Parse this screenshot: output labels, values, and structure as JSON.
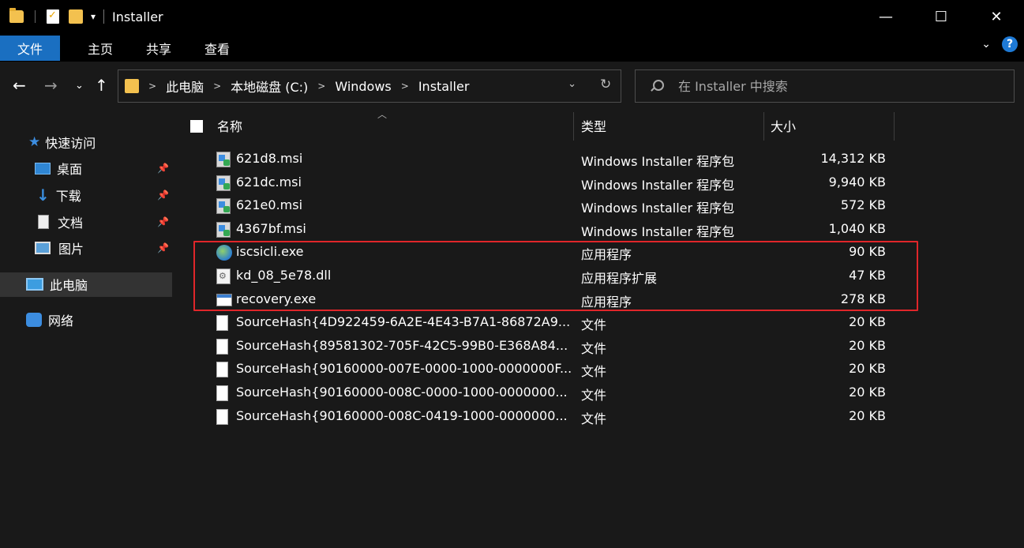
{
  "window": {
    "title": "Installer",
    "minimize": "—",
    "maximize": "☐",
    "close": "✕"
  },
  "ribbon": {
    "tabs": [
      "文件",
      "主页",
      "共享",
      "查看"
    ],
    "help": "?"
  },
  "address": {
    "crumbs": [
      "此电脑",
      "本地磁盘 (C:)",
      "Windows",
      "Installer"
    ],
    "search_placeholder": "在 Installer 中搜索"
  },
  "sidebar": {
    "quick_access": "快速访问",
    "items": [
      {
        "label": "桌面",
        "icon": "desktop-icon",
        "pinned": true
      },
      {
        "label": "下载",
        "icon": "download-icon",
        "pinned": true
      },
      {
        "label": "文档",
        "icon": "document-icon",
        "pinned": true
      },
      {
        "label": "图片",
        "icon": "picture-icon",
        "pinned": true
      }
    ],
    "this_pc": "此电脑",
    "network": "网络"
  },
  "columns": {
    "name": "名称",
    "type": "类型",
    "size": "大小"
  },
  "files": [
    {
      "name": "621d8.msi",
      "type": "Windows Installer 程序包",
      "size": "14,312 KB",
      "icon": "msi-icon"
    },
    {
      "name": "621dc.msi",
      "type": "Windows Installer 程序包",
      "size": "9,940 KB",
      "icon": "msi-icon"
    },
    {
      "name": "621e0.msi",
      "type": "Windows Installer 程序包",
      "size": "572 KB",
      "icon": "msi-icon"
    },
    {
      "name": "4367bf.msi",
      "type": "Windows Installer 程序包",
      "size": "1,040 KB",
      "icon": "msi-icon"
    },
    {
      "name": "iscsicli.exe",
      "type": "应用程序",
      "size": "90 KB",
      "icon": "globe-exe-icon"
    },
    {
      "name": "kd_08_5e78.dll",
      "type": "应用程序扩展",
      "size": "47 KB",
      "icon": "dll-icon"
    },
    {
      "name": "recovery.exe",
      "type": "应用程序",
      "size": "278 KB",
      "icon": "app-exe-icon"
    },
    {
      "name": "SourceHash{4D922459-6A2E-4E43-B7A1-86872A9...",
      "type": "文件",
      "size": "20 KB",
      "icon": "file-icon"
    },
    {
      "name": "SourceHash{89581302-705F-42C5-99B0-E368A84...",
      "type": "文件",
      "size": "20 KB",
      "icon": "file-icon"
    },
    {
      "name": "SourceHash{90160000-007E-0000-1000-0000000F...",
      "type": "文件",
      "size": "20 KB",
      "icon": "file-icon"
    },
    {
      "name": "SourceHash{90160000-008C-0000-1000-0000000...",
      "type": "文件",
      "size": "20 KB",
      "icon": "file-icon"
    },
    {
      "name": "SourceHash{90160000-008C-0419-1000-0000000...",
      "type": "文件",
      "size": "20 KB",
      "icon": "file-icon"
    }
  ],
  "colors": {
    "accent": "#1a6fc1",
    "highlight_box": "#e0262a",
    "background": "#191919"
  }
}
